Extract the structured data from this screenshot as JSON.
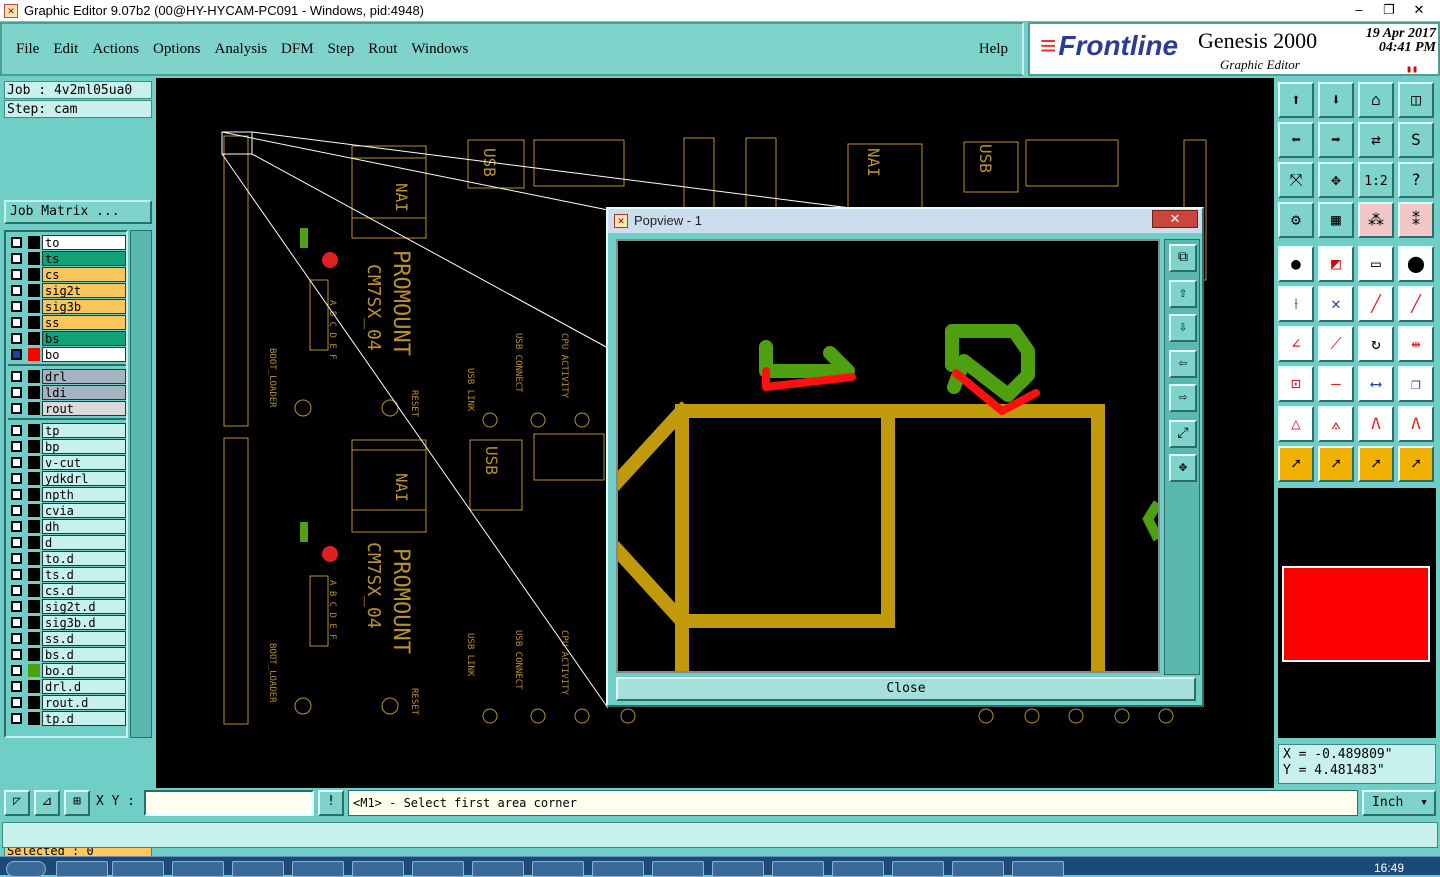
{
  "window": {
    "title": "Graphic Editor 9.07b2 (00@HY-HYCAM-PC091 - Windows, pid:4948)",
    "minimize": "–",
    "maximize": "❐",
    "close": "✕"
  },
  "menu": {
    "items": [
      "File",
      "Edit",
      "Actions",
      "Options",
      "Analysis",
      "DFM",
      "Step",
      "Rout",
      "Windows"
    ],
    "help": "Help"
  },
  "brand": {
    "logo": "Frontline",
    "product": "Genesis 2000",
    "subtitle": "Graphic Editor",
    "date": "19 Apr 2017",
    "time": "04:41 PM"
  },
  "job": {
    "job_label": "Job : 4v2ml05ua0",
    "step_label": "Step: cam",
    "matrix_button": "Job Matrix ...",
    "selected": "Selected : 0"
  },
  "layers": {
    "group1": [
      {
        "name": "to",
        "color": "#ffffff"
      },
      {
        "name": "ts",
        "color": "#13a178"
      },
      {
        "name": "cs",
        "color": "#f8c65a"
      },
      {
        "name": "sig2t",
        "color": "#f8c65a"
      },
      {
        "name": "sig3b",
        "color": "#f8c65a"
      },
      {
        "name": "ss",
        "color": "#f8c65a"
      },
      {
        "name": "bs",
        "color": "#13a178"
      },
      {
        "name": "bo",
        "color": "#ffffff",
        "active": true
      }
    ],
    "group2": [
      {
        "name": "drl",
        "color": "#a6b3c0"
      },
      {
        "name": "ldi",
        "color": "#a6b3c0"
      },
      {
        "name": "rout",
        "color": "#d9d9d9"
      }
    ],
    "group3": [
      {
        "name": "tp"
      },
      {
        "name": "bp"
      },
      {
        "name": "v-cut"
      },
      {
        "name": "ydkdrl"
      },
      {
        "name": "npth"
      },
      {
        "name": "cvia"
      },
      {
        "name": "dh"
      },
      {
        "name": "d"
      },
      {
        "name": "to.d"
      },
      {
        "name": "ts.d"
      },
      {
        "name": "cs.d"
      },
      {
        "name": "sig2t.d"
      },
      {
        "name": "sig3b.d"
      },
      {
        "name": "ss.d"
      },
      {
        "name": "bs.d"
      },
      {
        "name": "bo.d",
        "marked": true
      },
      {
        "name": "drl.d"
      },
      {
        "name": "rout.d"
      },
      {
        "name": "tp.d"
      }
    ]
  },
  "popview": {
    "title": "Popview - 1",
    "close_label": "Close",
    "close_x": "✕"
  },
  "coords": {
    "x": "X = -0.489809\"",
    "y": "Y = 4.481483\""
  },
  "status": {
    "xy_label": "X Y :",
    "xy_value": "",
    "bang": "!",
    "prompt": "<M1> - Select first area corner",
    "unit": "Inch"
  },
  "taskbar": {
    "clock": "16:49"
  },
  "colors": {
    "panel": "#6fcfc6",
    "copper": "#c09a0a",
    "pad_green": "#4fa010",
    "pad_red": "#ff1010",
    "silkscreen": "#b9902c",
    "active_layer": "#ff0000"
  }
}
